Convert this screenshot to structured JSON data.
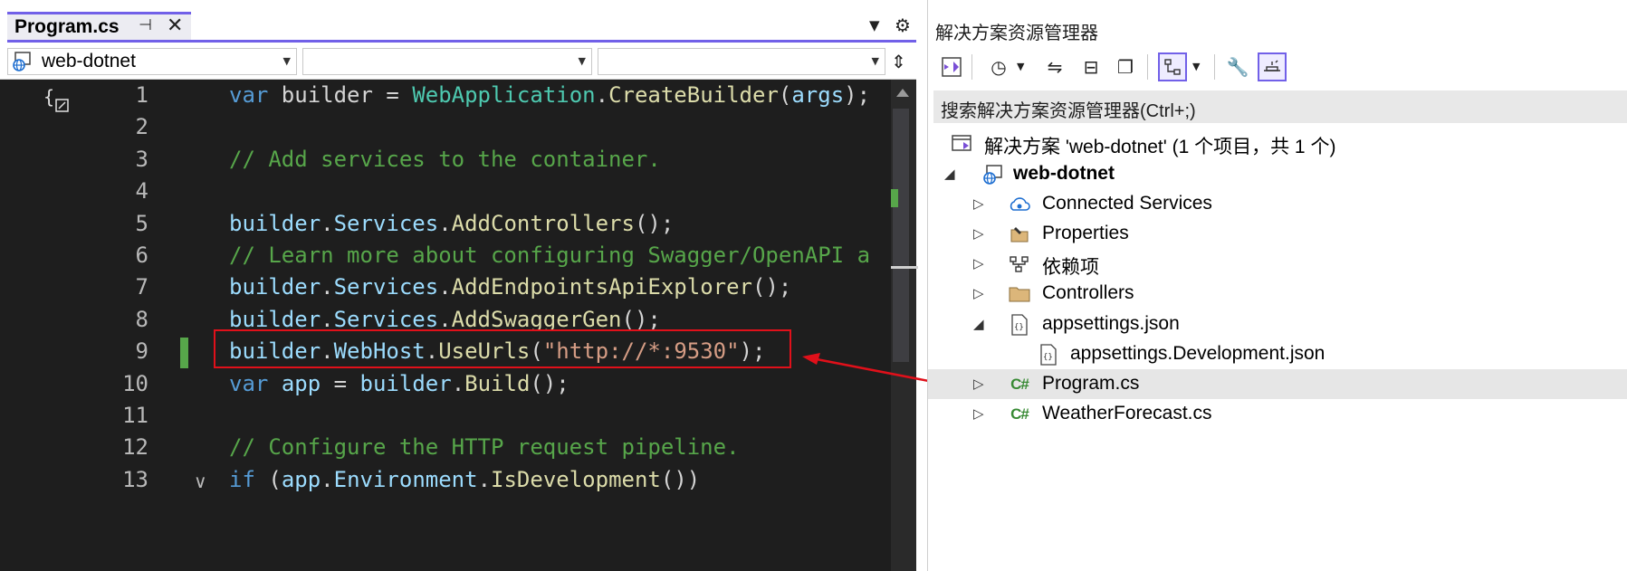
{
  "editor": {
    "tab": {
      "title": "Program.cs",
      "pin_icon": "pin-icon",
      "close_icon": "close-icon"
    },
    "nav": {
      "project": "web-dotnet",
      "type": "",
      "member": ""
    },
    "lines": [
      {
        "n": "1",
        "tokens": [
          [
            "k",
            "var"
          ],
          [
            "f",
            " builder = "
          ],
          [
            "t",
            "WebApplication"
          ],
          [
            "f",
            "."
          ],
          [
            "m",
            "CreateBuilder"
          ],
          [
            "f",
            "("
          ],
          [
            "p",
            "args"
          ],
          [
            "f",
            ");"
          ]
        ]
      },
      {
        "n": "2",
        "tokens": []
      },
      {
        "n": "3",
        "tokens": [
          [
            "c",
            "// Add services to the container."
          ]
        ]
      },
      {
        "n": "4",
        "tokens": []
      },
      {
        "n": "5",
        "tokens": [
          [
            "p",
            "builder"
          ],
          [
            "f",
            "."
          ],
          [
            "p",
            "Services"
          ],
          [
            "f",
            "."
          ],
          [
            "m",
            "AddControllers"
          ],
          [
            "f",
            "();"
          ]
        ]
      },
      {
        "n": "6",
        "tokens": [
          [
            "c",
            "// Learn more about configuring Swagger/OpenAPI a"
          ]
        ]
      },
      {
        "n": "7",
        "tokens": [
          [
            "p",
            "builder"
          ],
          [
            "f",
            "."
          ],
          [
            "p",
            "Services"
          ],
          [
            "f",
            "."
          ],
          [
            "m",
            "AddEndpointsApiExplorer"
          ],
          [
            "f",
            "();"
          ]
        ]
      },
      {
        "n": "8",
        "tokens": [
          [
            "p",
            "builder"
          ],
          [
            "f",
            "."
          ],
          [
            "p",
            "Services"
          ],
          [
            "f",
            "."
          ],
          [
            "m",
            "AddSwaggerGen"
          ],
          [
            "f",
            "();"
          ]
        ]
      },
      {
        "n": "9",
        "tokens": [
          [
            "p",
            "builder"
          ],
          [
            "f",
            "."
          ],
          [
            "p",
            "WebHost"
          ],
          [
            "f",
            "."
          ],
          [
            "m",
            "UseUrls"
          ],
          [
            "f",
            "("
          ],
          [
            "s",
            "\"http://*:9530\""
          ],
          [
            "f",
            ");"
          ]
        ]
      },
      {
        "n": "10",
        "tokens": [
          [
            "k",
            "var"
          ],
          [
            "f",
            " "
          ],
          [
            "p",
            "app"
          ],
          [
            "f",
            " = "
          ],
          [
            "p",
            "builder"
          ],
          [
            "f",
            "."
          ],
          [
            "m",
            "Build"
          ],
          [
            "f",
            "();"
          ]
        ]
      },
      {
        "n": "11",
        "tokens": []
      },
      {
        "n": "12",
        "tokens": [
          [
            "c",
            "// Configure the HTTP request pipeline."
          ]
        ]
      },
      {
        "n": "13",
        "tokens": [
          [
            "k",
            "if"
          ],
          [
            "f",
            " ("
          ],
          [
            "p",
            "app"
          ],
          [
            "f",
            "."
          ],
          [
            "p",
            "Environment"
          ],
          [
            "f",
            "."
          ],
          [
            "m",
            "IsDevelopment"
          ],
          [
            "f",
            "())"
          ]
        ]
      }
    ]
  },
  "explorer": {
    "title": "解决方案资源管理器",
    "search_placeholder": "搜索解决方案资源管理器(Ctrl+;)",
    "tree": [
      {
        "label": "解决方案 'web-dotnet' (1 个项目，共 1 个)",
        "icon": "solution-icon",
        "indent": 0,
        "expander": "",
        "bold": false
      },
      {
        "label": "web-dotnet",
        "icon": "project-icon",
        "indent": 1,
        "expander": "◢",
        "bold": true
      },
      {
        "label": "Connected Services",
        "icon": "connected-services-icon",
        "indent": 2,
        "expander": "▷",
        "bold": false
      },
      {
        "label": "Properties",
        "icon": "properties-icon",
        "indent": 2,
        "expander": "▷",
        "bold": false
      },
      {
        "label": "依赖项",
        "icon": "dependencies-icon",
        "indent": 2,
        "expander": "▷",
        "bold": false
      },
      {
        "label": "Controllers",
        "icon": "folder-icon",
        "indent": 2,
        "expander": "▷",
        "bold": false
      },
      {
        "label": "appsettings.json",
        "icon": "json-file-icon",
        "indent": 2,
        "expander": "◢",
        "bold": false
      },
      {
        "label": "appsettings.Development.json",
        "icon": "json-file-icon",
        "indent": 3,
        "expander": "",
        "bold": false
      },
      {
        "label": "Program.cs",
        "icon": "csharp-file-icon",
        "indent": 2,
        "expander": "▷",
        "bold": false,
        "selected": true
      },
      {
        "label": "WeatherForecast.cs",
        "icon": "csharp-file-icon",
        "indent": 2,
        "expander": "▷",
        "bold": false
      }
    ]
  },
  "colors": {
    "accent": "#7160e8",
    "annotation": "#e0101a",
    "change": "#57a64a"
  }
}
